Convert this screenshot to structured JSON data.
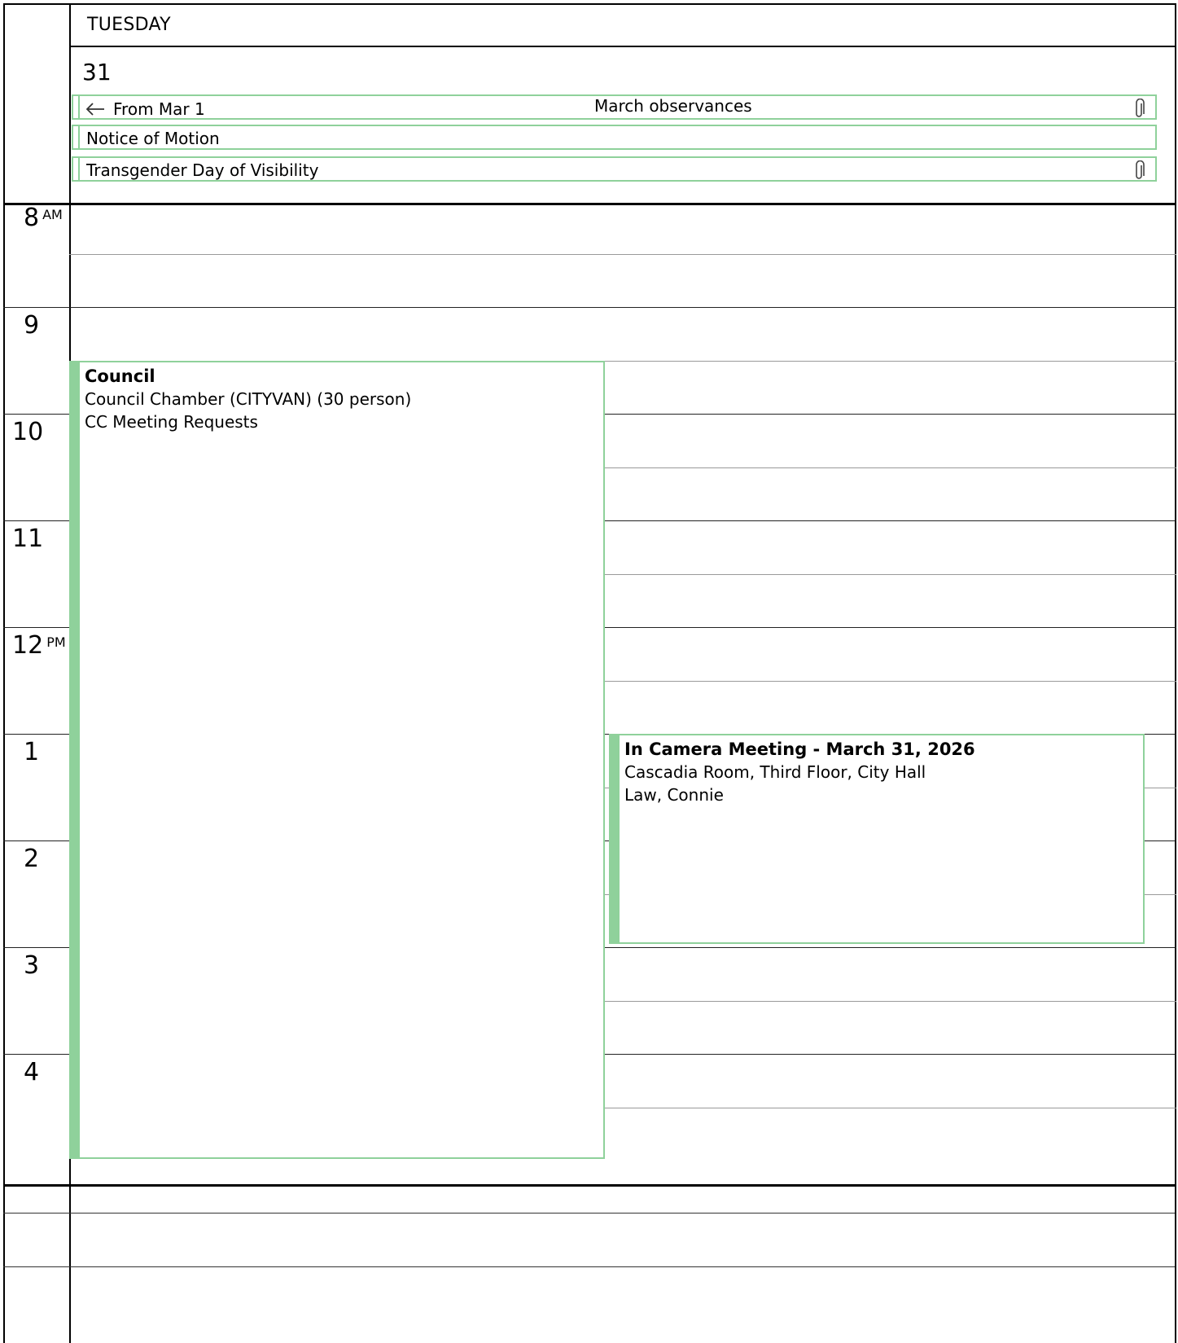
{
  "header": {
    "day_name": "TUESDAY",
    "day_number": "31"
  },
  "all_day_events": [
    {
      "arrow": "←",
      "from_label": "From Mar 1",
      "title": "March observances",
      "has_attachment": true
    },
    {
      "title": "Notice of Motion",
      "has_attachment": false
    },
    {
      "title": "Transgender Day of Visibility",
      "has_attachment": true
    }
  ],
  "time_labels": [
    {
      "hour": "8",
      "suffix": "AM"
    },
    {
      "hour": "9",
      "suffix": ""
    },
    {
      "hour": "10",
      "suffix": ""
    },
    {
      "hour": "11",
      "suffix": ""
    },
    {
      "hour": "12",
      "suffix": "PM"
    },
    {
      "hour": "1",
      "suffix": ""
    },
    {
      "hour": "2",
      "suffix": ""
    },
    {
      "hour": "3",
      "suffix": ""
    },
    {
      "hour": "4",
      "suffix": ""
    }
  ],
  "events": [
    {
      "title": "Council",
      "location": "Council Chamber (CITYVAN) (30 person)",
      "organizer": "CC Meeting Requests"
    },
    {
      "title": "In Camera Meeting - March 31, 2026",
      "location": "Cascadia Room, Third Floor, City Hall",
      "organizer": "Law, Connie"
    }
  ],
  "colors": {
    "event_accent": "#8fd19b",
    "grid_line": "#222222",
    "half_hour_line": "#9a9a9a"
  },
  "icons": {
    "attachment": "paperclip-icon",
    "continuation": "left-arrow-icon"
  }
}
